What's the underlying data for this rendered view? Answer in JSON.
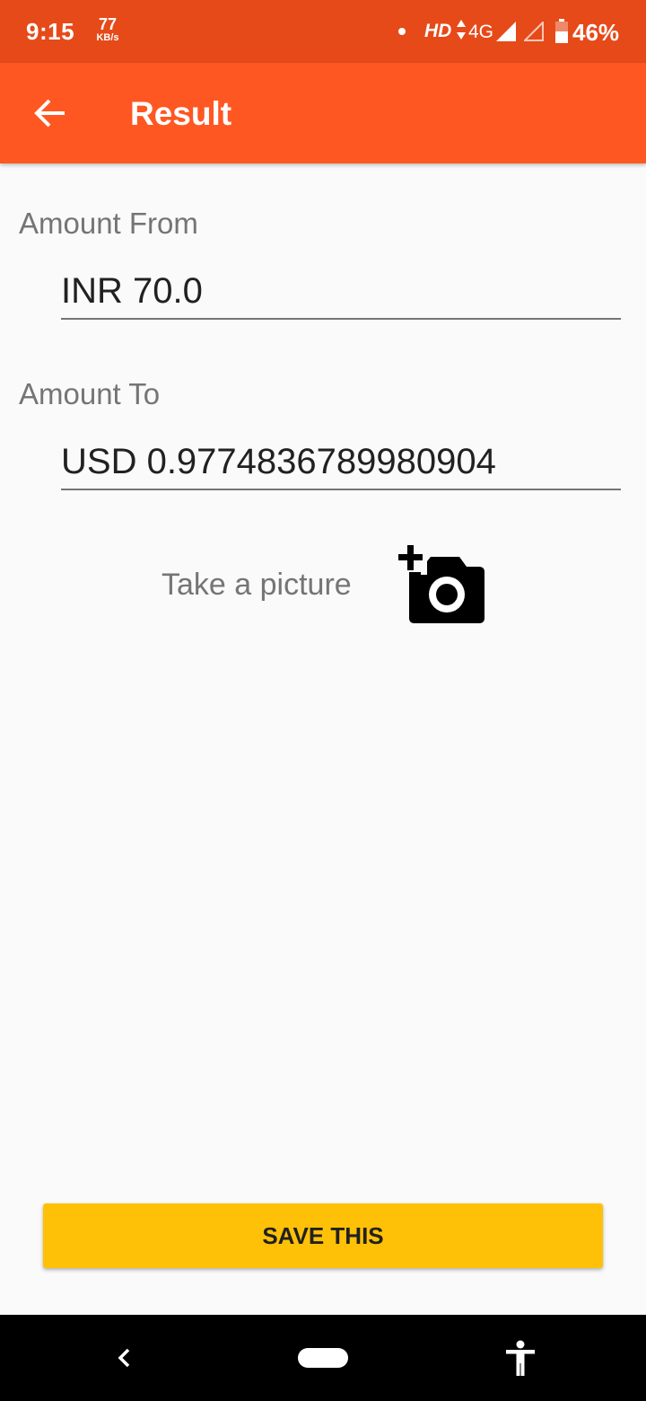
{
  "status_bar": {
    "time": "9:15",
    "net_speed_value": "77",
    "net_speed_unit": "KB/s",
    "hd": "HD",
    "network_type": "4G",
    "battery": "46%"
  },
  "app_bar": {
    "title": "Result",
    "back_icon": "arrow-back-icon"
  },
  "amount_from": {
    "label": "Amount From",
    "value": "INR 70.0"
  },
  "amount_to": {
    "label": "Amount To",
    "value": "USD 0.9774836789980904"
  },
  "picture": {
    "label": "Take a picture",
    "icon": "add-a-photo-icon"
  },
  "save_button": {
    "label": "SAVE THIS"
  },
  "nav_bar": {
    "back_icon": "chevron-left-icon",
    "home_icon": "home-pill-icon",
    "accessibility_icon": "accessibility-icon"
  },
  "colors": {
    "status_bar": "#e64a19",
    "app_bar": "#ff5722",
    "accent_button": "#ffc107",
    "background": "#fafafa",
    "label_gray": "#757575",
    "text_dark": "#212121"
  }
}
